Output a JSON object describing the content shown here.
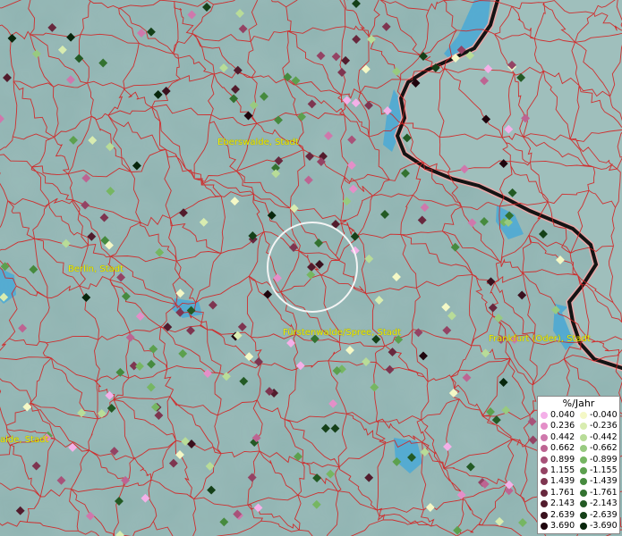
{
  "map": {
    "labels": [
      {
        "name": "Eberswalde, Stadt"
      },
      {
        "name": "Berlin, Stadt"
      },
      {
        "name": "Fürstenwalde/Spree, Stadt"
      },
      {
        "name": "Frankfurt (Oder), Stadt"
      },
      {
        "name": "alde, Stadt"
      }
    ],
    "colors": {
      "land": "#8fb3b1",
      "border_lines": "#d42020",
      "water": "#3fa7d8",
      "national_border": "#1a1a1a",
      "selection_circle": "#f0f0f0"
    }
  },
  "legend": {
    "title": "%/Jahr",
    "positive": [
      {
        "value": "0.040",
        "color": "#f4b0e8"
      },
      {
        "value": "0.236",
        "color": "#e48fc8"
      },
      {
        "value": "0.442",
        "color": "#cf78ac"
      },
      {
        "value": "0.662",
        "color": "#bd6492"
      },
      {
        "value": "0.899",
        "color": "#a85279"
      },
      {
        "value": "1.155",
        "color": "#944364"
      },
      {
        "value": "1.439",
        "color": "#7e3550"
      },
      {
        "value": "1.761",
        "color": "#68283e"
      },
      {
        "value": "2.143",
        "color": "#521c2d"
      },
      {
        "value": "2.639",
        "color": "#3a111e"
      },
      {
        "value": "3.690",
        "color": "#1e050d"
      }
    ],
    "negative": [
      {
        "value": "-0.040",
        "color": "#f4f8c6"
      },
      {
        "value": "-0.236",
        "color": "#d8ecb0"
      },
      {
        "value": "-0.442",
        "color": "#b8dc98"
      },
      {
        "value": "-0.662",
        "color": "#98ca80"
      },
      {
        "value": "-0.899",
        "color": "#76b662"
      },
      {
        "value": "-1.155",
        "color": "#5ca04e"
      },
      {
        "value": "-1.439",
        "color": "#468a3e"
      },
      {
        "value": "-1.761",
        "color": "#337230"
      },
      {
        "value": "-2.143",
        "color": "#235a24"
      },
      {
        "value": "-2.639",
        "color": "#154018"
      },
      {
        "value": "-3.690",
        "color": "#08260c"
      }
    ]
  }
}
